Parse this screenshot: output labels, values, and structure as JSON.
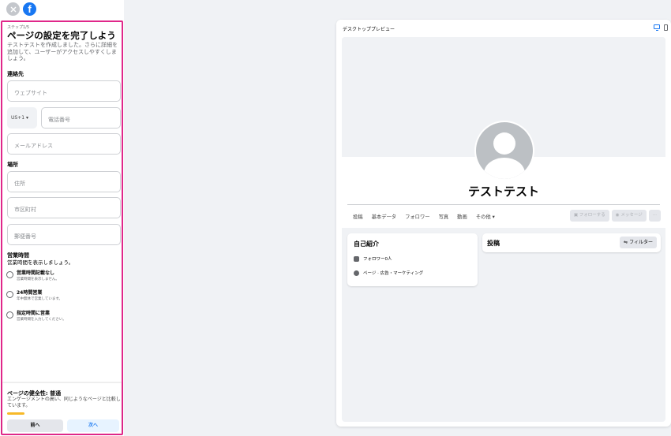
{
  "sidebar": {
    "step": "ステップ1/5",
    "title": "ページの設定を完了しよう",
    "description": "テストテストを作成しました。さらに詳細を追加して、ユーザーがアクセスしやすくしましょう。",
    "contact_label": "連絡先",
    "website_placeholder": "ウェブサイト",
    "country_code": "US+1 ▾",
    "phone_placeholder": "電話番号",
    "email_placeholder": "メールアドレス",
    "location_label": "場所",
    "address_placeholder": "住所",
    "city_placeholder": "市区町村",
    "zip_placeholder": "郵便番号",
    "hours_label": "営業時間",
    "hours_desc": "営業時間を表示しましょう。",
    "hours_options": [
      {
        "label": "営業時間記載なし",
        "sub": "営業時間を表示しません。"
      },
      {
        "label": "24時間営業",
        "sub": "年中無休で営業しています。"
      },
      {
        "label": "指定時間に営業",
        "sub": "営業時間を入力してください。"
      }
    ],
    "health_title": "ページの健全性: 普通",
    "health_desc": "エンゲージメントの高い、同じようなページと比較しています。",
    "health_progress": 0.15,
    "prev_button": "前へ",
    "next_button": "次へ"
  },
  "preview": {
    "title": "デスクトッププレビュー",
    "page_name": "テストテスト",
    "tabs": [
      "投稿",
      "基本データ",
      "フォロワー",
      "写真",
      "動画",
      "その他 ▾"
    ],
    "follow_button": "フォローする",
    "message_button": "メッセージ",
    "more_button": "···",
    "intro_title": "自己紹介",
    "intro_items": [
      "フォロワー0人",
      "ページ · 広告・マーケティング"
    ],
    "posts_title": "投稿",
    "filter_button": "フィルター"
  },
  "colors": {
    "accent": "#1877f2",
    "highlight_border": "#e0278a",
    "health_bar": "#f7b928"
  }
}
